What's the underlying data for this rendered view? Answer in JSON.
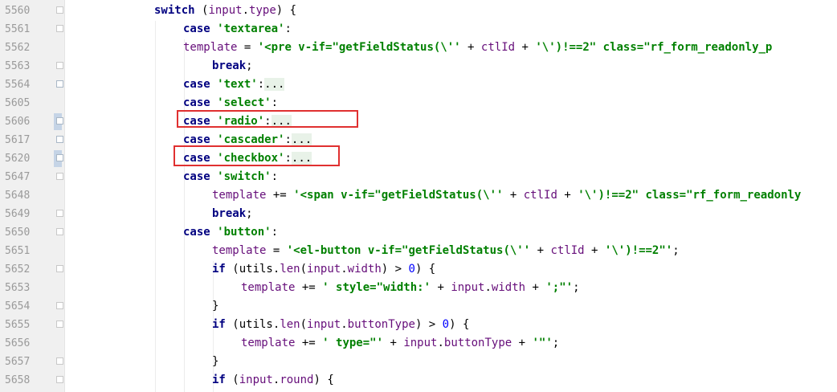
{
  "editor": {
    "lines": [
      {
        "num": "5560",
        "fold": "open"
      },
      {
        "num": "5561",
        "fold": "open"
      },
      {
        "num": "5562",
        "fold": "none"
      },
      {
        "num": "5563",
        "fold": "open"
      },
      {
        "num": "5564",
        "fold": "plus"
      },
      {
        "num": "5605",
        "fold": "none"
      },
      {
        "num": "5606",
        "fold": "plus-hl"
      },
      {
        "num": "5617",
        "fold": "plus"
      },
      {
        "num": "5620",
        "fold": "plus-hl"
      },
      {
        "num": "5647",
        "fold": "open"
      },
      {
        "num": "5648",
        "fold": "none"
      },
      {
        "num": "5649",
        "fold": "open"
      },
      {
        "num": "5650",
        "fold": "open"
      },
      {
        "num": "5651",
        "fold": "none"
      },
      {
        "num": "5652",
        "fold": "open"
      },
      {
        "num": "5653",
        "fold": "none"
      },
      {
        "num": "5654",
        "fold": "open"
      },
      {
        "num": "5655",
        "fold": "open"
      },
      {
        "num": "5656",
        "fold": "none"
      },
      {
        "num": "5657",
        "fold": "open"
      },
      {
        "num": "5658",
        "fold": "open"
      }
    ],
    "tokens": {
      "l0": [
        "switch",
        " (",
        "input",
        ".",
        "type",
        ") {"
      ],
      "l1": [
        "case",
        " ",
        "'textarea'",
        ":"
      ],
      "l2": [
        "template",
        " = ",
        "'<pre v-if=\"getFieldStatus(\\''",
        " + ",
        "ctlId",
        " + ",
        "'\\')!==2\" class=\"rf_form_readonly_p"
      ],
      "l3": [
        "break",
        ";"
      ],
      "l4": [
        "case",
        " ",
        "'text'",
        ":",
        "..."
      ],
      "l5": [
        "case",
        " ",
        "'select'",
        ":"
      ],
      "l6": [
        "case",
        " ",
        "'radio'",
        ":",
        "..."
      ],
      "l7": [
        "case",
        " ",
        "'cascader'",
        ":",
        "..."
      ],
      "l8": [
        "case",
        " ",
        "'checkbox'",
        ":",
        "..."
      ],
      "l9": [
        "case",
        " ",
        "'switch'",
        ":"
      ],
      "l10": [
        "template",
        " += ",
        "'<span v-if=\"getFieldStatus(\\''",
        " + ",
        "ctlId",
        " + ",
        "'\\')!==2\" class=\"rf_form_readonly"
      ],
      "l11": [
        "break",
        ";"
      ],
      "l12": [
        "case",
        " ",
        "'button'",
        ":"
      ],
      "l13": [
        "template",
        " = ",
        "'<el-button v-if=\"getFieldStatus(\\''",
        " + ",
        "ctlId",
        " + ",
        "'\\')!==2\"'",
        ";"
      ],
      "l14": [
        "if",
        " (",
        "utils",
        ".",
        "len",
        "(",
        "input",
        ".",
        "width",
        ") > ",
        "0",
        ") {"
      ],
      "l15": [
        "template",
        " += ",
        "' style=\"width:'",
        " + ",
        "input",
        ".",
        "width",
        " + ",
        "';\"'",
        ";"
      ],
      "l16": [
        "}"
      ],
      "l17": [
        "if",
        " (",
        "utils",
        ".",
        "len",
        "(",
        "input",
        ".",
        "buttonType",
        ") > ",
        "0",
        ") {"
      ],
      "l18": [
        "template",
        " += ",
        "' type=\"'",
        " + ",
        "input",
        ".",
        "buttonType",
        " + ",
        "'\"'",
        ";"
      ],
      "l19": [
        "}"
      ],
      "l20": [
        "if",
        " (",
        "input",
        ".",
        "round",
        ") {"
      ]
    }
  }
}
